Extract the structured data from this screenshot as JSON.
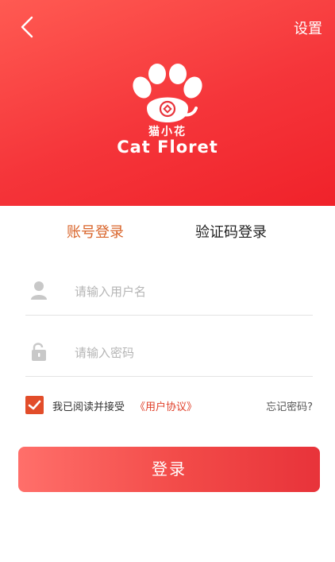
{
  "header": {
    "settings_label": "设置",
    "brand_cn": "猫小花",
    "brand_en": "Cat Floret"
  },
  "tabs": [
    {
      "label": "账号登录",
      "active": true
    },
    {
      "label": "验证码登录",
      "active": false
    }
  ],
  "form": {
    "username_placeholder": "请输入用户名",
    "password_placeholder": "请输入密码"
  },
  "agreement": {
    "checked": true,
    "text": "我已阅读并接受",
    "link": "《用户协议》",
    "forgot": "忘记密码?"
  },
  "login_button": "登录",
  "colors": {
    "header_red": "#f5353a",
    "accent_orange": "#d9642a",
    "checkbox": "#e24d2a",
    "link_red": "#e0402a"
  }
}
